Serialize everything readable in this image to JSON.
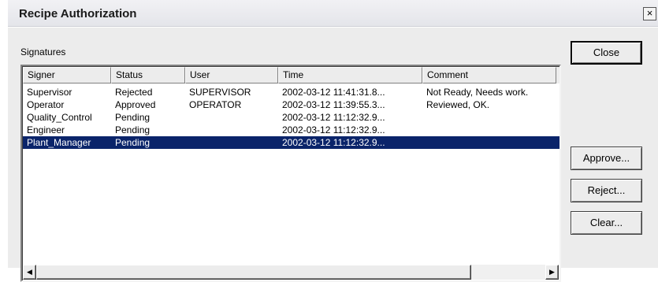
{
  "window": {
    "title": "Recipe Authorization",
    "close_glyph": "×"
  },
  "signatures_label": "Signatures",
  "columns": [
    "Signer",
    "Status",
    "User",
    "Time",
    "Comment"
  ],
  "rows": [
    {
      "signer": "Supervisor",
      "status": "Rejected",
      "user": "SUPERVISOR",
      "time": "2002-03-12  11:41:31.8...",
      "comment": "Not Ready, Needs work."
    },
    {
      "signer": "Operator",
      "status": "Approved",
      "user": "OPERATOR",
      "time": "2002-03-12  11:39:55.3...",
      "comment": "Reviewed, OK."
    },
    {
      "signer": "Quality_Control",
      "status": "Pending",
      "user": "",
      "time": "2002-03-12  11:12:32.9...",
      "comment": ""
    },
    {
      "signer": "Engineer",
      "status": "Pending",
      "user": "",
      "time": "2002-03-12  11:12:32.9...",
      "comment": ""
    },
    {
      "signer": "Plant_Manager",
      "status": "Pending",
      "user": "",
      "time": "2002-03-12  11:12:32.9...",
      "comment": "",
      "selected": true
    }
  ],
  "buttons": {
    "close": "Close",
    "approve": "Approve...",
    "reject": "Reject...",
    "clear": "Clear..."
  },
  "scrollbar": {
    "left_arrow": "◀",
    "right_arrow": "▶"
  },
  "colors": {
    "selection": "#0a246a",
    "face": "#ececec"
  }
}
